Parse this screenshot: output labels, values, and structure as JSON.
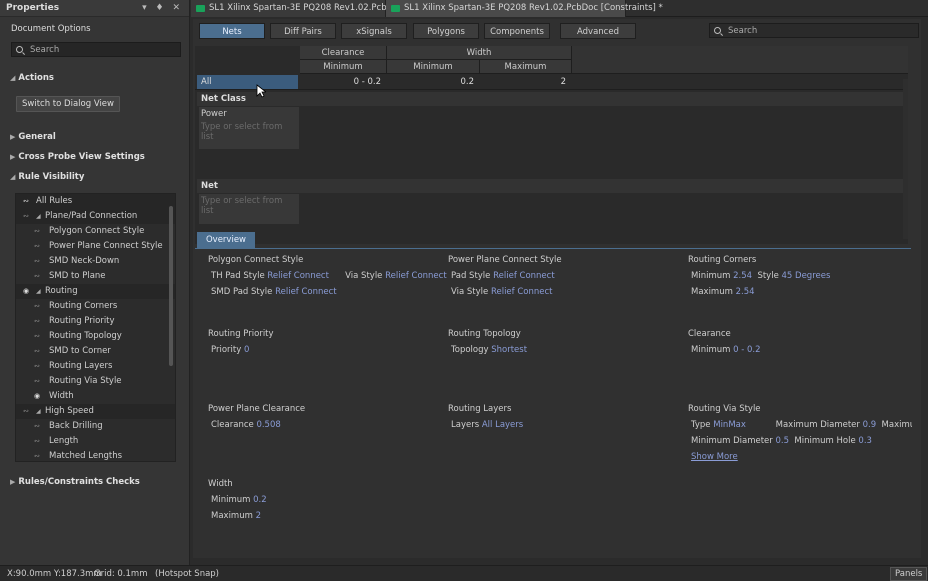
{
  "properties": {
    "title": "Properties",
    "controls": "▾ ♦ ✕",
    "doc_options": "Document Options",
    "search_placeholder": "Search",
    "actions_label": "Actions",
    "switch_button": "Switch to Dialog View",
    "general": "General",
    "cross_probe": "Cross Probe View Settings",
    "rule_visibility": "Rule Visibility",
    "rules_checks": "Rules/Constraints Checks",
    "tree": [
      {
        "label": "All Rules",
        "kind": "root"
      },
      {
        "label": "Plane/Pad Connection",
        "kind": "group"
      },
      {
        "label": "Polygon Connect Style",
        "kind": "item"
      },
      {
        "label": "Power Plane Connect Style",
        "kind": "item"
      },
      {
        "label": "SMD Neck-Down",
        "kind": "item"
      },
      {
        "label": "SMD to Plane",
        "kind": "item"
      },
      {
        "label": "Routing",
        "kind": "group"
      },
      {
        "label": "Routing Corners",
        "kind": "item"
      },
      {
        "label": "Routing Priority",
        "kind": "item"
      },
      {
        "label": "Routing Topology",
        "kind": "item"
      },
      {
        "label": "SMD to Corner",
        "kind": "item"
      },
      {
        "label": "Routing Layers",
        "kind": "item"
      },
      {
        "label": "Routing Via Style",
        "kind": "item"
      },
      {
        "label": "Width",
        "kind": "item-on"
      },
      {
        "label": "High Speed",
        "kind": "group"
      },
      {
        "label": "Back Drilling",
        "kind": "item"
      },
      {
        "label": "Length",
        "kind": "item"
      },
      {
        "label": "Matched Lengths",
        "kind": "item"
      }
    ]
  },
  "tabs": [
    {
      "label": "SL1 Xilinx Spartan-3E PQ208 Rev1.02.PcbDoc *"
    },
    {
      "label": "SL1 Xilinx Spartan-3E PQ208 Rev1.02.PcbDoc [Constraints] *"
    }
  ],
  "filters": [
    "Nets",
    "Diff Pairs",
    "xSignals",
    "Polygons",
    "Components",
    "Advanced"
  ],
  "search_placeholder": "Search",
  "grid": {
    "h_clearance": "Clearance",
    "h_width": "Width",
    "sub_min1": "Minimum",
    "sub_min2": "Minimum",
    "sub_max": "Maximum",
    "row_all": "All",
    "v_clear": "0 - 0.2",
    "v_wmin": "0.2",
    "v_wmax": "2",
    "netclass": "Net Class",
    "power": "Power",
    "hint1": "Type or select from list",
    "net": "Net",
    "hint2": "Type or select from list"
  },
  "overview_tab": "Overview",
  "overview": {
    "pcs": {
      "title": "Polygon Connect Style",
      "th_l": "TH Pad Style",
      "th_v": "Relief Connect",
      "via_l": "Via Style",
      "via_v": "Relief Connect",
      "smd_l": "SMD Pad Style",
      "smd_v": "Relief Connect"
    },
    "ppcs": {
      "title": "Power Plane Connect Style",
      "pad_l": "Pad Style",
      "pad_v": "Relief Connect",
      "via_l": "Via Style",
      "via_v": "Relief Connect"
    },
    "rc": {
      "title": "Routing Corners",
      "min_l": "Minimum",
      "min_v": "2.54",
      "style_l": "Style",
      "style_v": "45 Degrees",
      "max_l": "Maximum",
      "max_v": "2.54"
    },
    "rp": {
      "title": "Routing Priority",
      "l": "Priority",
      "v": "0"
    },
    "rt": {
      "title": "Routing Topology",
      "l": "Topology",
      "v": "Shortest"
    },
    "cl": {
      "title": "Clearance",
      "l": "Minimum",
      "v": "0 - 0.2"
    },
    "ppc": {
      "title": "Power Plane Clearance",
      "l": "Clearance",
      "v": "0.508"
    },
    "rl": {
      "title": "Routing Layers",
      "l": "Layers",
      "v": "All Layers"
    },
    "rvs": {
      "title": "Routing Via Style",
      "type_l": "Type",
      "type_v": "MinMax",
      "maxd_l": "Maximum Diameter",
      "maxd_v": "0.9",
      "maxu": "Maximu",
      "mind_l": "Minimum Diameter",
      "mind_v": "0.5",
      "minh_l": "Minimum Hole",
      "minh_v": "0.3",
      "more": "Show More"
    },
    "w": {
      "title": "Width",
      "min_l": "Minimum",
      "min_v": "0.2",
      "max_l": "Maximum",
      "max_v": "2"
    }
  },
  "status": {
    "coords": "X:90.0mm Y:187.3mm",
    "grid": "Grid: 0.1mm",
    "snap": "(Hotspot Snap)",
    "panels": "Panels"
  }
}
